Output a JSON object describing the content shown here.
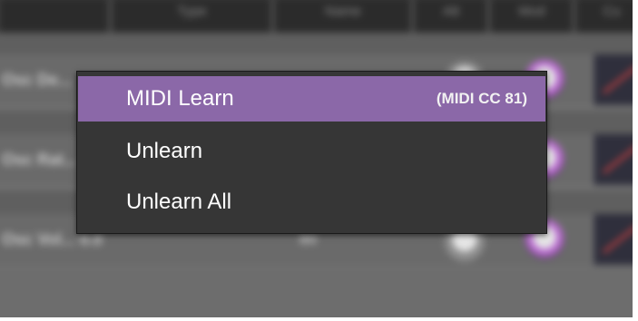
{
  "background": {
    "header_columns": [
      "",
      "Type",
      "Name",
      "Att",
      "Mod",
      "Cu"
    ],
    "rows": [
      {
        "label": "Osc De...",
        "value": ""
      },
      {
        "label": "Osc Rat...",
        "value": ""
      },
      {
        "label": "Osc Vol... 0.0",
        "value": "80"
      }
    ]
  },
  "context_menu": {
    "items": [
      {
        "label": "MIDI Learn",
        "shortcut": "(MIDI CC 81)",
        "highlighted": true
      },
      {
        "label": "Unlearn",
        "shortcut": ""
      },
      {
        "label": "Unlearn All",
        "shortcut": ""
      }
    ]
  },
  "colors": {
    "menu_highlight": "#8b68a8",
    "menu_background": "#363636",
    "knob_accent": "#b96bd0",
    "envelope_line": "#d24040"
  }
}
